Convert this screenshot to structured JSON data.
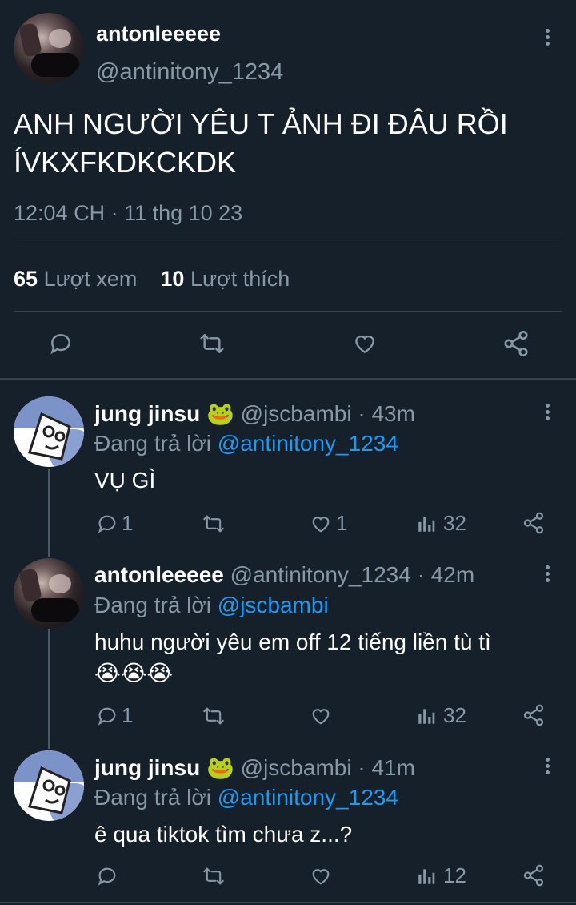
{
  "main_tweet": {
    "display_name": "antonleeeee",
    "handle": "@antinitony_1234",
    "text_line1": "ANH NGƯỜI YÊU T ẢNH ĐI ĐÂU RỒI",
    "text_line2": "ÍVKXFKDKCKDK",
    "timestamp": "12:04 CH · 11 thg 10 23",
    "views_count": "65",
    "views_label": "Lượt xem",
    "likes_count": "10",
    "likes_label": "Lượt thích"
  },
  "replies": [
    {
      "display_name": "jung jinsu",
      "emoji": "🐸",
      "handle_time": "@jscbambi · 43m",
      "replying_label": "Đang trả lời",
      "replying_to": "@antinitony_1234",
      "text_line1": "VỤ GÌ",
      "text_line2": "",
      "reply_count": "1",
      "retweet_count": "",
      "like_count": "1",
      "view_count": "32"
    },
    {
      "display_name": "antonleeeee",
      "emoji": "",
      "handle_time": "@antinitony_1234 · 42m",
      "replying_label": "Đang trả lời",
      "replying_to": "@jscbambi",
      "text_line1": "huhu người yêu em off 12 tiếng liền tù tì",
      "text_line2": "😭😭😭",
      "reply_count": "1",
      "retweet_count": "",
      "like_count": "",
      "view_count": "32"
    },
    {
      "display_name": "jung jinsu",
      "emoji": "🐸",
      "handle_time": "@jscbambi · 41m",
      "replying_label": "Đang trả lời",
      "replying_to": "@antinitony_1234",
      "text_line1": "ê qua tiktok tìm chưa z...?",
      "text_line2": "",
      "reply_count": "",
      "retweet_count": "",
      "like_count": "",
      "view_count": "12"
    }
  ],
  "icons": {
    "more": "more-vertical-icon",
    "reply": "reply-bubble-icon",
    "retweet": "retweet-icon",
    "like": "heart-icon",
    "views": "views-bar-chart-icon",
    "share": "share-icon"
  },
  "colors": {
    "background": "#15202b",
    "text": "#ffffff",
    "muted": "#8899a6",
    "link": "#1d9bf0",
    "divider": "#38444d"
  }
}
